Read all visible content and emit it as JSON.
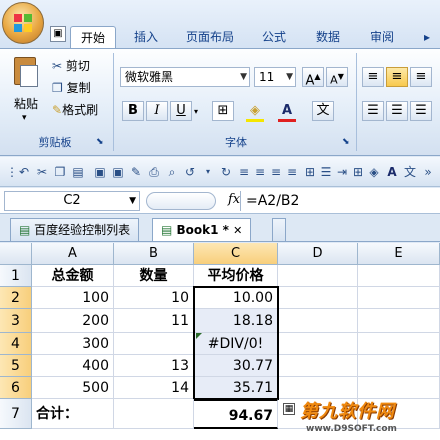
{
  "colors": {
    "accent": "#15428b",
    "selection_border": "#000000",
    "header_selected": "#f8cf7c"
  },
  "tabs": [
    "开始",
    "插入",
    "页面布局",
    "公式",
    "数据",
    "审阅"
  ],
  "ribbon": {
    "clipboard": {
      "paste": "粘贴",
      "cut": "剪切",
      "copy": "复制",
      "format_painter": "格式刷",
      "label": "剪贴板"
    },
    "font": {
      "name": "微软雅黑",
      "size": "11",
      "bold": "B",
      "italic": "I",
      "underline": "U",
      "label": "字体",
      "grow": "A",
      "shrink": "A",
      "font_color": "A",
      "wen": "文"
    }
  },
  "formula_bar": {
    "name_box": "C2",
    "fx": "fx",
    "formula": "=A2/B2"
  },
  "workbook_tabs": [
    "百度经验控制列表",
    "Book1 *"
  ],
  "columns": [
    "A",
    "B",
    "C",
    "D",
    "E"
  ],
  "rows": [
    {
      "n": "1",
      "a": "总金额",
      "b": "数量",
      "c": "平均价格"
    },
    {
      "n": "2",
      "a": "100",
      "b": "10",
      "c": "10.00"
    },
    {
      "n": "3",
      "a": "200",
      "b": "11",
      "c": "18.18"
    },
    {
      "n": "4",
      "a": "300",
      "b": "",
      "c": "#DIV/0!"
    },
    {
      "n": "5",
      "a": "400",
      "b": "13",
      "c": "30.77"
    },
    {
      "n": "6",
      "a": "500",
      "b": "14",
      "c": "35.71"
    },
    {
      "n": "7",
      "a": "合计：",
      "b": "",
      "c": "94.67"
    }
  ],
  "watermark": {
    "title": "第九软件网",
    "url": "www.D9SOFT.com"
  }
}
